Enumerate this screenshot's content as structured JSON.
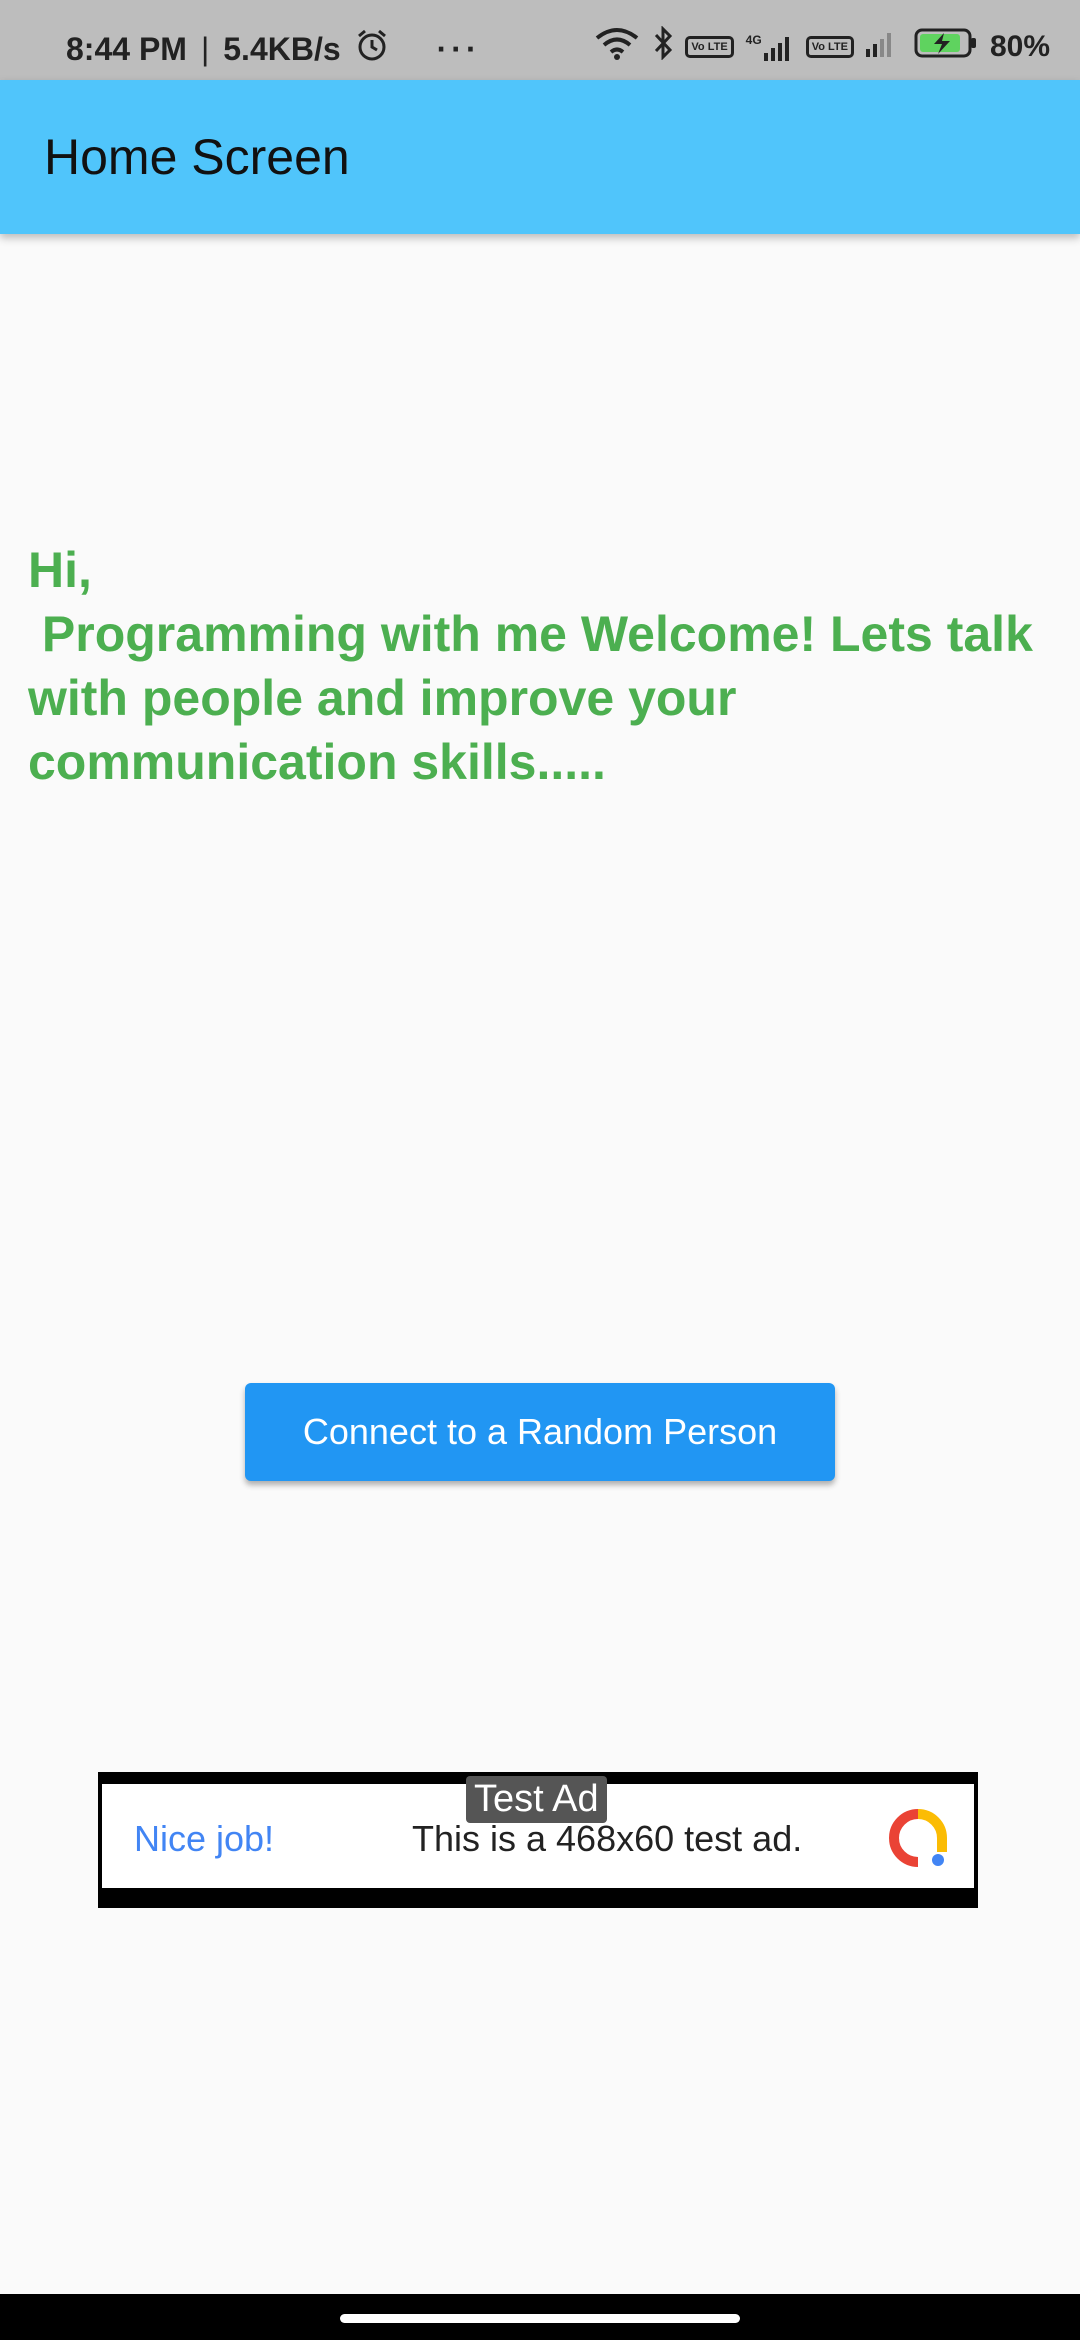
{
  "status_bar": {
    "time": "8:44 PM",
    "network_speed": "5.4KB/s",
    "more_dots": "···",
    "network_badge_1": "Vo LTE",
    "network_type": "4G",
    "network_badge_2": "Vo LTE",
    "battery": "80%",
    "icons": [
      "alarm-icon",
      "wifi-icon",
      "bluetooth-icon",
      "signal-icon",
      "battery-charging-icon"
    ]
  },
  "app_bar": {
    "title": "Home Screen",
    "color": "#50c5fb"
  },
  "main": {
    "welcome_text": "Hi,\n Programming with me Welcome! Lets talk with people and improve your communication skills.....",
    "welcome_color": "#4caf50",
    "connect_button_label": "Connect to a Random Person",
    "button_color": "#2196f3"
  },
  "ad": {
    "label": "Test Ad",
    "headline": "Nice job!",
    "body": "This is a 468x60 test ad.",
    "logo_icon": "google-ads-logo-icon"
  }
}
